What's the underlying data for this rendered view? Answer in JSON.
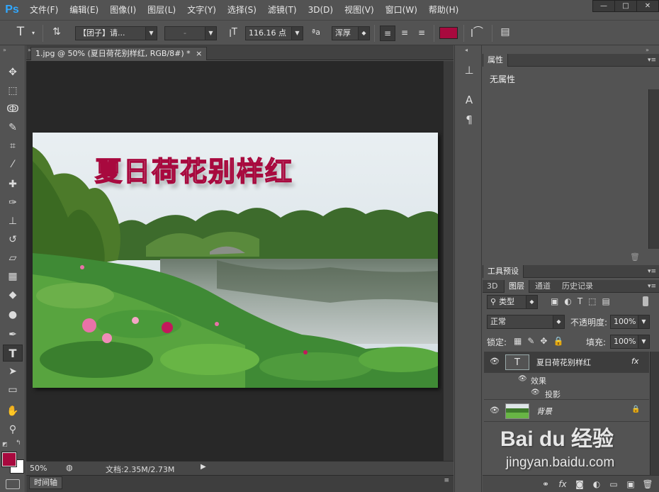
{
  "app": {
    "logo": "Ps"
  },
  "menu": [
    "文件(F)",
    "编辑(E)",
    "图像(I)",
    "图层(L)",
    "文字(Y)",
    "选择(S)",
    "滤镜(T)",
    "3D(D)",
    "视图(V)",
    "窗口(W)",
    "帮助(H)"
  ],
  "window_controls": [
    "—",
    "□",
    "✕"
  ],
  "options": {
    "font_family": "【团子】请...",
    "font_style": "-",
    "font_size": "116.16 点",
    "aa_label": "ªa",
    "antialias": "浑厚",
    "text_color": "#a8093e"
  },
  "document": {
    "tab_title": "1.jpg @ 50% (夏日荷花别样红, RGB/8#) *",
    "tab_close": "×",
    "overlay_text": "夏日荷花别样红",
    "text_color": "#a8093e"
  },
  "status": {
    "zoom": "50%",
    "doc_info": "文档:2.35M/2.73M"
  },
  "timeline": {
    "label": "时间轴"
  },
  "colors": {
    "foreground": "#a8093e",
    "background": "#ffffff"
  },
  "properties_panel": {
    "tab": "属性",
    "message": "无属性"
  },
  "tool_presets_panel": {
    "tab": "工具预设"
  },
  "layers_panel": {
    "tabs": [
      "3D",
      "图层",
      "通道",
      "历史记录"
    ],
    "filter_label": "类型",
    "blend_mode": "正常",
    "opacity_label": "不透明度:",
    "opacity": "100%",
    "lock_label": "锁定:",
    "fill_label": "填充:",
    "fill": "100%",
    "layers": [
      {
        "name": "夏日荷花别样红",
        "fx": "fx",
        "effects_label": "效果",
        "effect": "投影"
      },
      {
        "name": "背景"
      }
    ]
  },
  "watermark": {
    "brand": "Bai du 经验",
    "url": "jingyan.baidu.com"
  }
}
